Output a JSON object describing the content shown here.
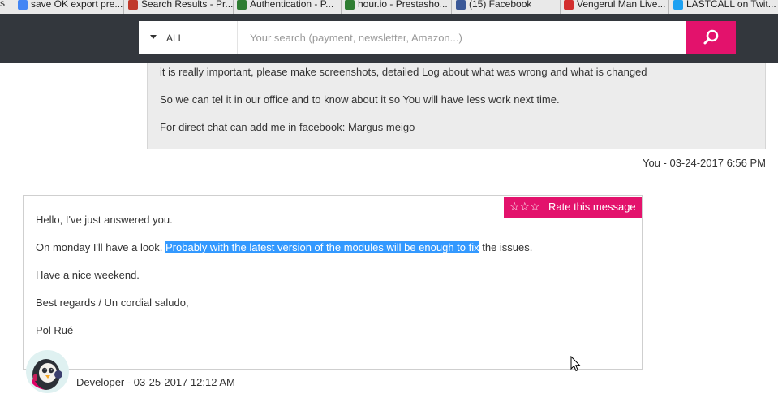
{
  "bookmarks": [
    {
      "label": "save OK export pre...",
      "color": "#4285f4"
    },
    {
      "label": "Search Results - Pr...",
      "color": "#c0392b"
    },
    {
      "label": "Authentication - P...",
      "color": "#2e7d32"
    },
    {
      "label": "hour.io - Prestasho...",
      "color": "#2e7d32"
    },
    {
      "label": "(15) Facebook",
      "color": "#3b5998"
    },
    {
      "label": "Vengerul Man Live...",
      "color": "#d32f2f"
    },
    {
      "label": "LASTCALL on Twit...",
      "color": "#1da1f2"
    }
  ],
  "search": {
    "category": "ALL",
    "placeholder": "Your search (payment, newsletter, Amazon...)",
    "value": ""
  },
  "previous_message": {
    "lines": [
      "it is really important, please make screenshots, detailed Log about what was wrong and what is changed",
      "So we can tel it in our office and to know about it so You will have less work next time.",
      "For direct chat can add me in facebook: Margus meigo"
    ],
    "meta": "You - 03-24-2017 6:56 PM"
  },
  "answer_message": {
    "greeting": "Hello, I've just answered you.",
    "line2_before": "On monday I'll have a look. ",
    "line2_highlight": "Probably with the latest version of the modules will be enough to fix",
    "line2_after": " the issues.",
    "weekend": "Have a nice weekend.",
    "regards": "Best regards / Un cordial saludo,",
    "signature": "Pol Rué",
    "rate_label": "Rate this message",
    "rate_stars": "☆☆☆",
    "meta": "Developer - 03-25-2017 12:12 AM"
  },
  "colors": {
    "header_bg": "#33373d",
    "accent": "#e3126c",
    "selection": "#3399ff",
    "bubble_bg": "#ececec"
  },
  "icons": [
    "search-icon",
    "star-icon",
    "chevron-down-icon",
    "avatar-icon",
    "mouse-cursor-icon"
  ]
}
